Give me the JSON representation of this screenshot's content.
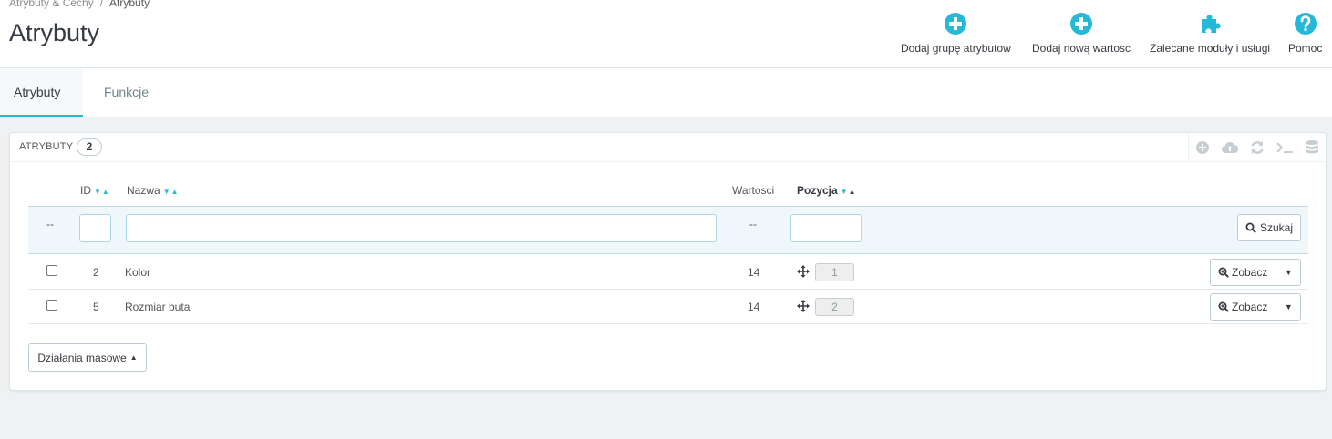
{
  "breadcrumb": {
    "parent": "Atrybuty & Cechy",
    "separator": "/",
    "current": "Atrybuty"
  },
  "page": {
    "title": "Atrybuty"
  },
  "toolbar": {
    "add_group": "Dodaj grupę atrybutow",
    "add_value": "Dodaj nową wartosc",
    "modules": "Zalecane moduły i usługi",
    "help": "Pomoc"
  },
  "tabs": [
    {
      "label": "Atrybuty",
      "active": true
    },
    {
      "label": "Funkcje",
      "active": false
    }
  ],
  "panel": {
    "title": "Atrybuty",
    "count": "2",
    "tools": [
      "add-icon",
      "cloud-upload-icon",
      "refresh-icon",
      "terminal-icon",
      "database-icon"
    ]
  },
  "table": {
    "columns": {
      "id": "ID",
      "name": "Nazwa",
      "values": "Wartosci",
      "position": "Pozycja"
    },
    "filter": {
      "dash": "--",
      "search_label": "Szukaj"
    },
    "rows": [
      {
        "id": "2",
        "name": "Kolor",
        "values": "14",
        "position": "1",
        "action": "Zobacz"
      },
      {
        "id": "5",
        "name": "Rozmiar buta",
        "values": "14",
        "position": "2",
        "action": "Zobacz"
      }
    ]
  },
  "bulk": {
    "label": "Działania masowe"
  },
  "colors": {
    "accent": "#25b9d7",
    "text": "#363a41",
    "background": "#eff1f2"
  }
}
